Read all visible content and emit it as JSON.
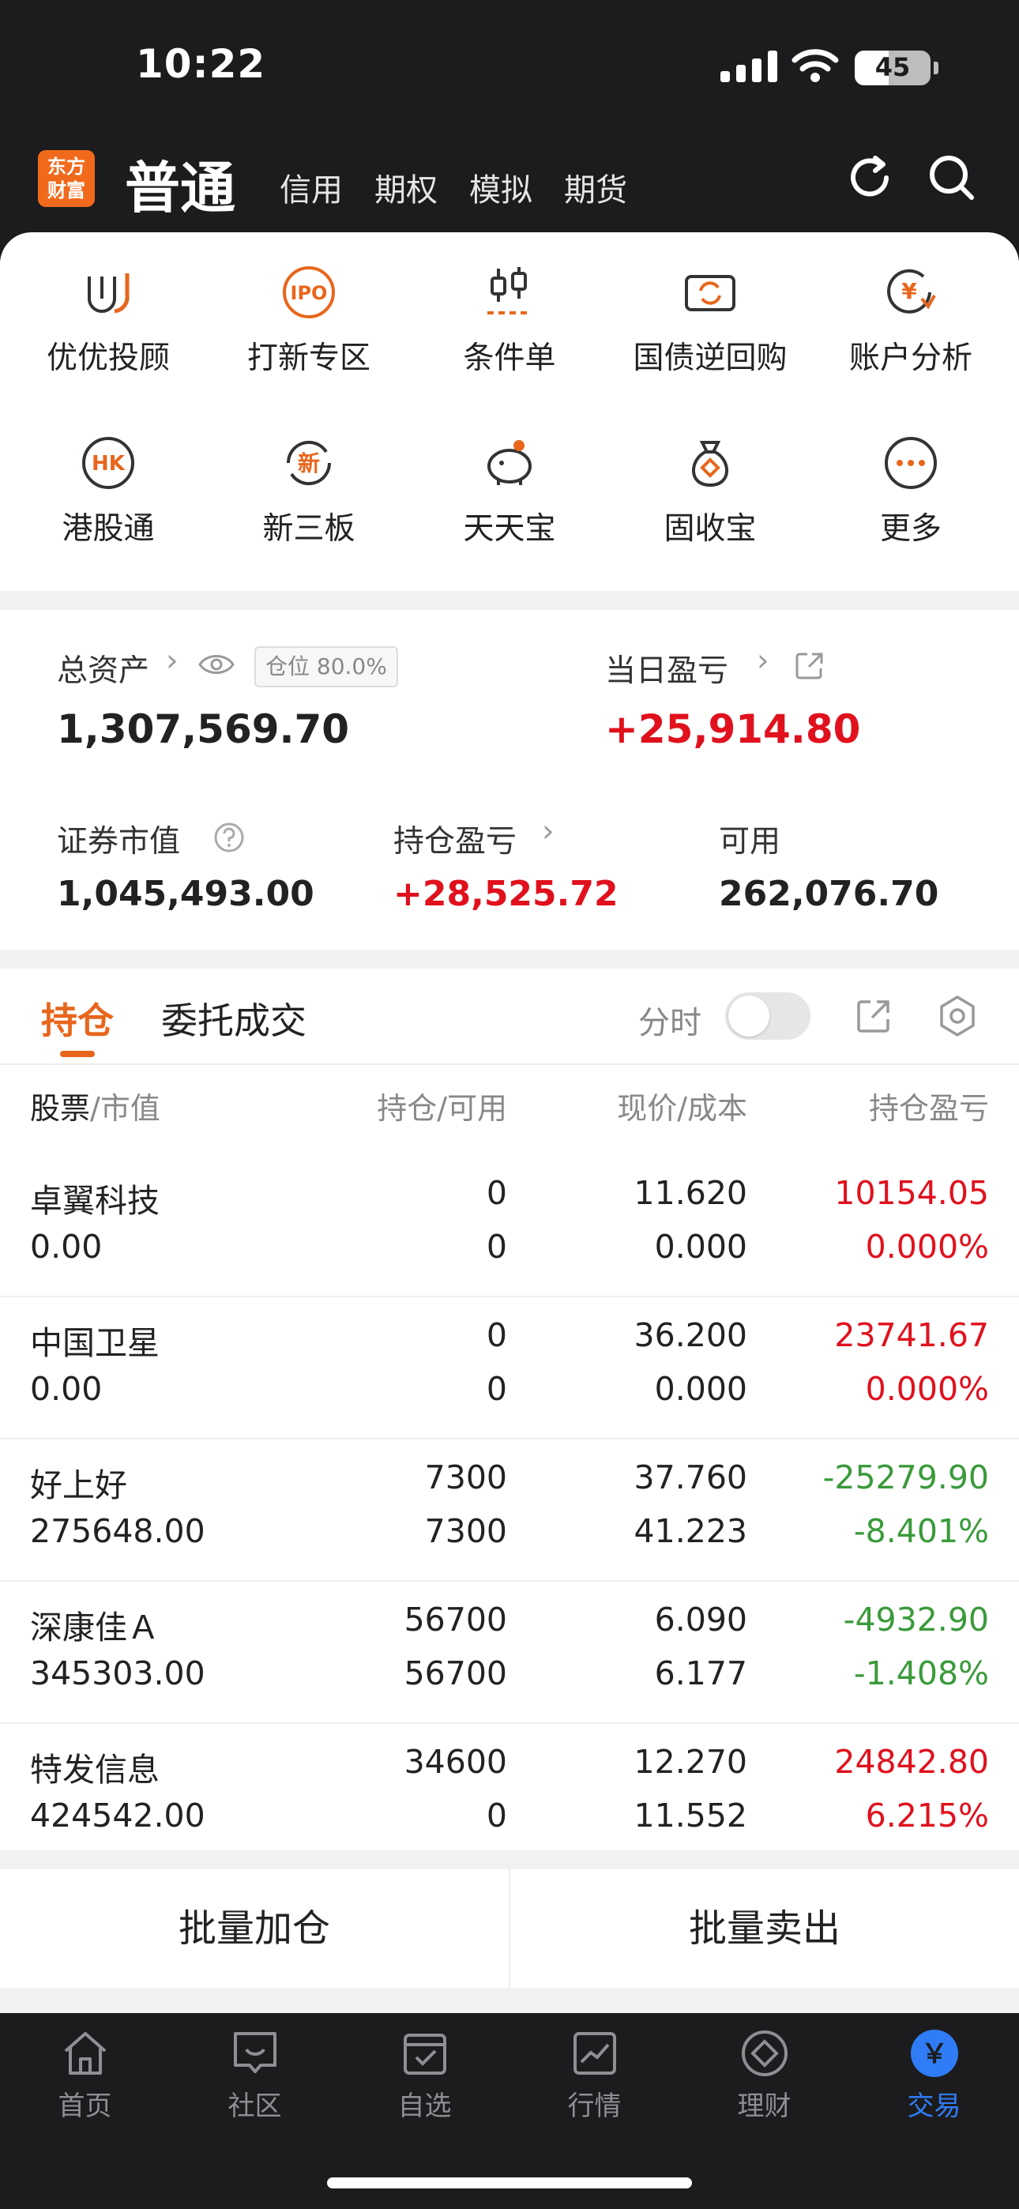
{
  "status": {
    "time": "10:22",
    "battery": "45"
  },
  "header": {
    "logo": [
      "东方",
      "财富"
    ],
    "active_mode": "普通",
    "modes": [
      "信用",
      "期权",
      "模拟",
      "期货"
    ]
  },
  "quick": [
    {
      "label": "优优投顾",
      "icon": "uu-advisor-icon"
    },
    {
      "label": "打新专区",
      "icon": "ipo-icon",
      "glyph": "IPO"
    },
    {
      "label": "条件单",
      "icon": "condition-order-icon"
    },
    {
      "label": "国债逆回购",
      "icon": "reverse-repo-icon"
    },
    {
      "label": "账户分析",
      "icon": "account-analysis-icon",
      "glyph": "¥"
    },
    {
      "label": "港股通",
      "icon": "hk-connect-icon",
      "glyph": "HK"
    },
    {
      "label": "新三板",
      "icon": "neeq-icon",
      "glyph": "新"
    },
    {
      "label": "天天宝",
      "icon": "piggy-bank-icon"
    },
    {
      "label": "固收宝",
      "icon": "money-bag-icon"
    },
    {
      "label": "更多",
      "icon": "more-icon"
    }
  ],
  "account": {
    "total_assets_label": "总资产",
    "total_assets": "1,307,569.70",
    "position_ratio": "仓位 80.0%",
    "daily_pl_label": "当日盈亏",
    "daily_pl": "+25,914.80",
    "market_value_label": "证券市值",
    "market_value": "1,045,493.00",
    "holding_pl_label": "持仓盈亏",
    "holding_pl": "+28,525.72",
    "available_label": "可用",
    "available": "262,076.70"
  },
  "holdings": {
    "tab_active": "持仓",
    "tab_other": "委托成交",
    "intraday_label": "分时",
    "intraday_on": false,
    "columns": {
      "name_a": "股票",
      "name_b": "/市值",
      "qty": "持仓/可用",
      "price": "现价/成本",
      "pl": "持仓盈亏"
    },
    "rows": [
      {
        "name": "卓翼科技",
        "market_value": "0.00",
        "qty": "0",
        "available": "0",
        "price": "11.620",
        "cost": "0.000",
        "pl": "10154.05",
        "pl_pct": "0.000%",
        "trend": "up"
      },
      {
        "name": "中国卫星",
        "market_value": "0.00",
        "qty": "0",
        "available": "0",
        "price": "36.200",
        "cost": "0.000",
        "pl": "23741.67",
        "pl_pct": "0.000%",
        "trend": "up"
      },
      {
        "name": "好上好",
        "market_value": "275648.00",
        "qty": "7300",
        "available": "7300",
        "price": "37.760",
        "cost": "41.223",
        "pl": "-25279.90",
        "pl_pct": "-8.401%",
        "trend": "down"
      },
      {
        "name": "深康佳Ａ",
        "market_value": "345303.00",
        "qty": "56700",
        "available": "56700",
        "price": "6.090",
        "cost": "6.177",
        "pl": "-4932.90",
        "pl_pct": "-1.408%",
        "trend": "down"
      },
      {
        "name": "特发信息",
        "market_value": "424542.00",
        "qty": "34600",
        "available": "0",
        "price": "12.270",
        "cost": "11.552",
        "pl": "24842.80",
        "pl_pct": "6.215%",
        "trend": "up"
      }
    ],
    "batch_add": "批量加仓",
    "batch_sell": "批量卖出"
  },
  "tabbar": [
    {
      "label": "首页",
      "icon": "home-icon"
    },
    {
      "label": "社区",
      "icon": "community-icon"
    },
    {
      "label": "自选",
      "icon": "watchlist-icon"
    },
    {
      "label": "行情",
      "icon": "market-icon"
    },
    {
      "label": "理财",
      "icon": "wealth-icon"
    },
    {
      "label": "交易",
      "icon": "trade-icon",
      "glyph": "￥",
      "active": true
    }
  ],
  "colors": {
    "accent": "#e8661c",
    "up": "#e0111d",
    "down": "#3a9a3a",
    "tab_active": "#2f7cf6"
  }
}
